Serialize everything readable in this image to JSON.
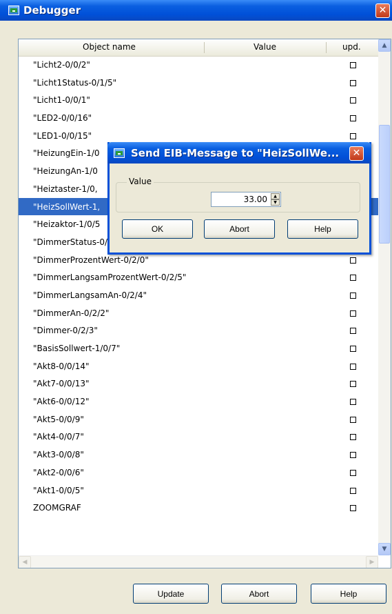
{
  "window": {
    "title": "Debugger",
    "close_glyph": "✕"
  },
  "list": {
    "columns": {
      "name": "Object name",
      "value": "Value",
      "upd": "upd."
    },
    "rows": [
      "\"Licht2-0/0/2\"",
      "\"Licht1Status-0/1/5\"",
      "\"Licht1-0/0/1\"",
      "\"LED2-0/0/16\"",
      "\"LED1-0/0/15\"",
      "\"HeizungEin-1/0",
      "\"HeizungAn-1/0",
      "\"Heiztaster-1/0,",
      "\"HeizSollWert-1,",
      "\"Heizaktor-1/0/5",
      "\"DimmerStatus-0/2/1\"",
      "\"DimmerProzentWert-0/2/0\"",
      "\"DimmerLangsamProzentWert-0/2/5\"",
      "\"DimmerLangsamAn-0/2/4\"",
      "\"DimmerAn-0/2/2\"",
      "\"Dimmer-0/2/3\"",
      "\"BasisSollwert-1/0/7\"",
      "\"Akt8-0/0/14\"",
      "\"Akt7-0/0/13\"",
      "\"Akt6-0/0/12\"",
      "\"Akt5-0/0/9\"",
      "\"Akt4-0/0/7\"",
      "\"Akt3-0/0/8\"",
      "\"Akt2-0/0/6\"",
      "\"Akt1-0/0/5\"",
      "ZOOMGRAF"
    ],
    "selected_index": 8
  },
  "scrollbar": {
    "up": "▲",
    "down": "▼",
    "left": "◀",
    "right": "▶"
  },
  "buttons": {
    "update": "Update",
    "abort": "Abort",
    "help": "Help"
  },
  "dialog": {
    "title": "Send EIB-Message to \"HeizSollWe...",
    "close_glyph": "✕",
    "group_label": "Value",
    "value": "33.00",
    "ok": "OK",
    "abort": "Abort",
    "help": "Help"
  },
  "colors": {
    "titlebar": "#0050d8",
    "selection": "#316ac5",
    "face": "#ece9d8",
    "close": "#c0391a"
  },
  "icons": [
    "app-icon",
    "close-icon",
    "scroll-up-icon",
    "scroll-down-icon",
    "scroll-left-icon",
    "scroll-right-icon"
  ]
}
